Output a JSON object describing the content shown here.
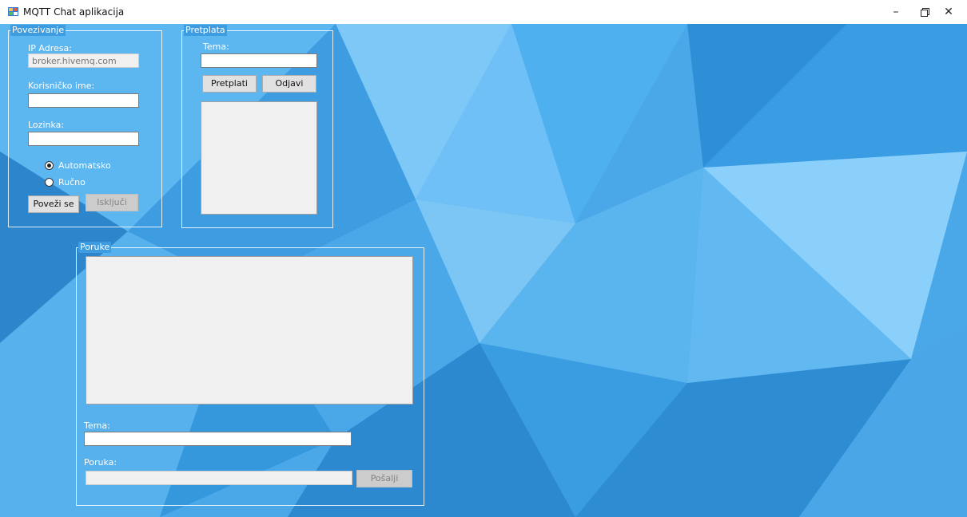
{
  "window": {
    "title": "MQTT Chat aplikacija",
    "minimize_icon": "minimize-icon",
    "restore_icon": "restore-icon",
    "close_icon": "close-icon"
  },
  "connection": {
    "group_title": "Povezivanje",
    "ip_label": "IP Adresa:",
    "ip_value": "broker.hivemq.com",
    "username_label": "Korisničko ime:",
    "username_value": "",
    "password_label": "Lozinka:",
    "password_value": "",
    "radio_auto": "Automatsko",
    "radio_manual": "Ručno",
    "selected_mode": "Automatsko",
    "connect_button": "Poveži se",
    "disconnect_button": "Isključi"
  },
  "subscription": {
    "group_title": "Pretplata",
    "topic_label": "Tema:",
    "topic_value": "",
    "subscribe_button": "Pretplati",
    "unsubscribe_button": "Odjavi",
    "topics": []
  },
  "messages": {
    "group_title": "Poruke",
    "items": [],
    "topic_label": "Tema:",
    "topic_value": "",
    "message_label": "Poruka:",
    "message_value": "",
    "send_button": "Pošalji"
  },
  "colors": {
    "background_base": "#4aa8e8",
    "group_border": "#ffffff"
  }
}
